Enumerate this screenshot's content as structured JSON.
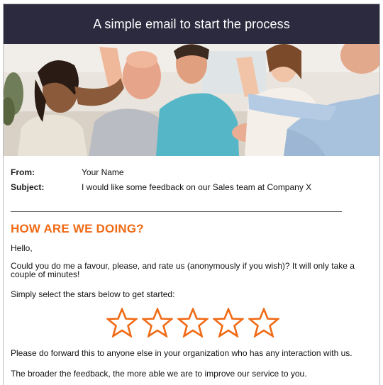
{
  "header": {
    "title": "A simple email to start the process"
  },
  "email": {
    "from_label": "From:",
    "from_value": "Your Name",
    "subject_label": "Subject:",
    "subject_value": "I would like some feedback on our Sales team at Company X"
  },
  "body": {
    "heading": "HOW ARE WE DOING?",
    "greeting": "Hello,",
    "request": "Could you do me a favour, please, and rate us (anonymously if you wish)? It will only take a couple of minutes!",
    "instruction": "Simply select the stars below to get started:",
    "forward_note": "Please do forward this to anyone else in your organization who has any interaction with us.",
    "closing": "The broader the feedback, the more able we are to improve our service to you."
  },
  "rating": {
    "max_stars": 5,
    "selected": 0,
    "star_color": "#f06a15"
  },
  "colors": {
    "header_bg": "#2b2a3f",
    "accent": "#f06a15"
  }
}
